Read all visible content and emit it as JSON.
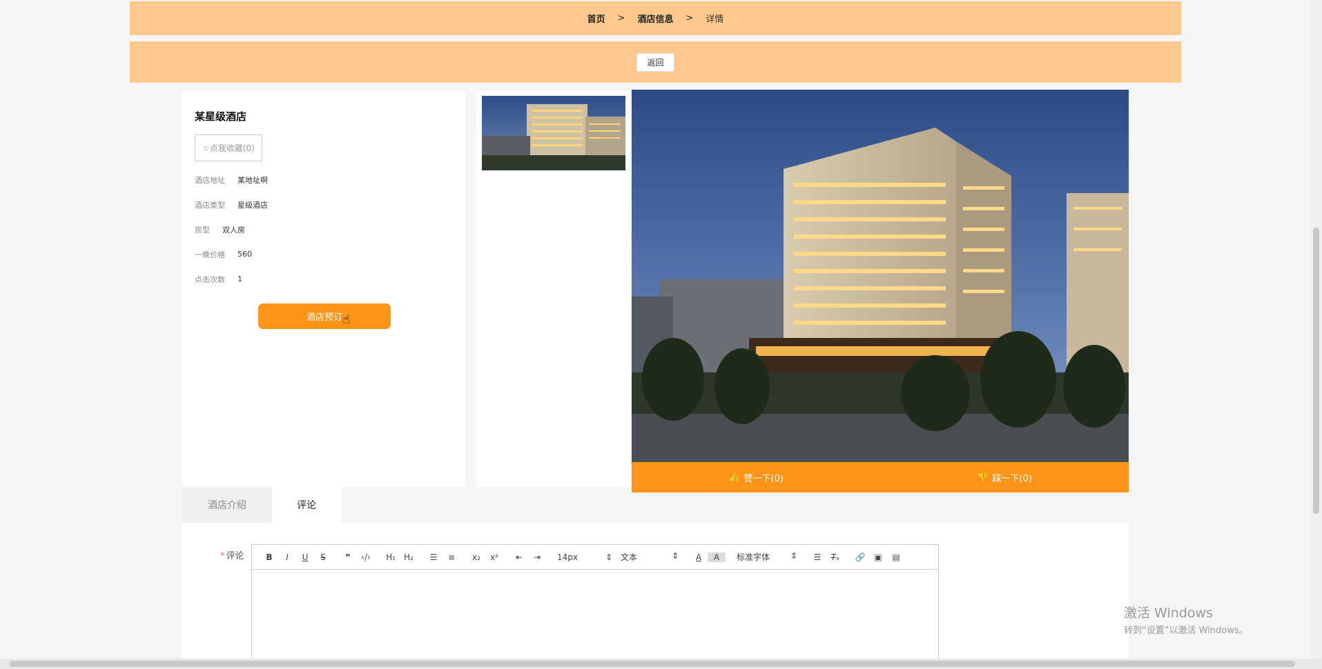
{
  "breadcrumb": {
    "home": "首页",
    "sep1": ">",
    "section": "酒店信息",
    "sep2": ">",
    "current": "详情"
  },
  "actions": {
    "back_label": "返回"
  },
  "hotel": {
    "name": "某星级酒店",
    "favorite_label": "☆点我收藏(0)",
    "fields": [
      {
        "key": "酒店地址",
        "value": "某地址啊"
      },
      {
        "key": "酒店类型",
        "value": "星级酒店"
      },
      {
        "key": "房型",
        "value": "双人房"
      },
      {
        "key": "一晚价格",
        "value": "560"
      },
      {
        "key": "点击次数",
        "value": "1"
      }
    ],
    "book_label": "酒店预订"
  },
  "votes": {
    "like_label": "赞一下(0)",
    "dislike_label": "踩一下(0)"
  },
  "tabs": {
    "intro": "酒店介绍",
    "comment": "评论"
  },
  "comment_form": {
    "required_mark": "*",
    "label": "评论",
    "size_select": "14px",
    "format_select": "文本",
    "font_select": "标准字体"
  },
  "toolbar_icons": [
    "bold-icon",
    "italic-icon",
    "underline-icon",
    "strike-icon",
    "blockquote-icon",
    "code-icon",
    "h1-icon",
    "h2-icon",
    "ordered-list-icon",
    "bullet-list-icon",
    "subscript-icon",
    "superscript-icon",
    "outdent-icon",
    "indent-icon",
    "font-color-icon",
    "background-color-icon",
    "align-icon",
    "clear-format-icon",
    "link-icon",
    "image-icon",
    "video-icon"
  ],
  "watermark": {
    "line1": "激活 Windows",
    "line2": "转到“设置”以激活 Windows。"
  },
  "colors": {
    "band": "#ffc88c",
    "accent": "#fb9418"
  }
}
